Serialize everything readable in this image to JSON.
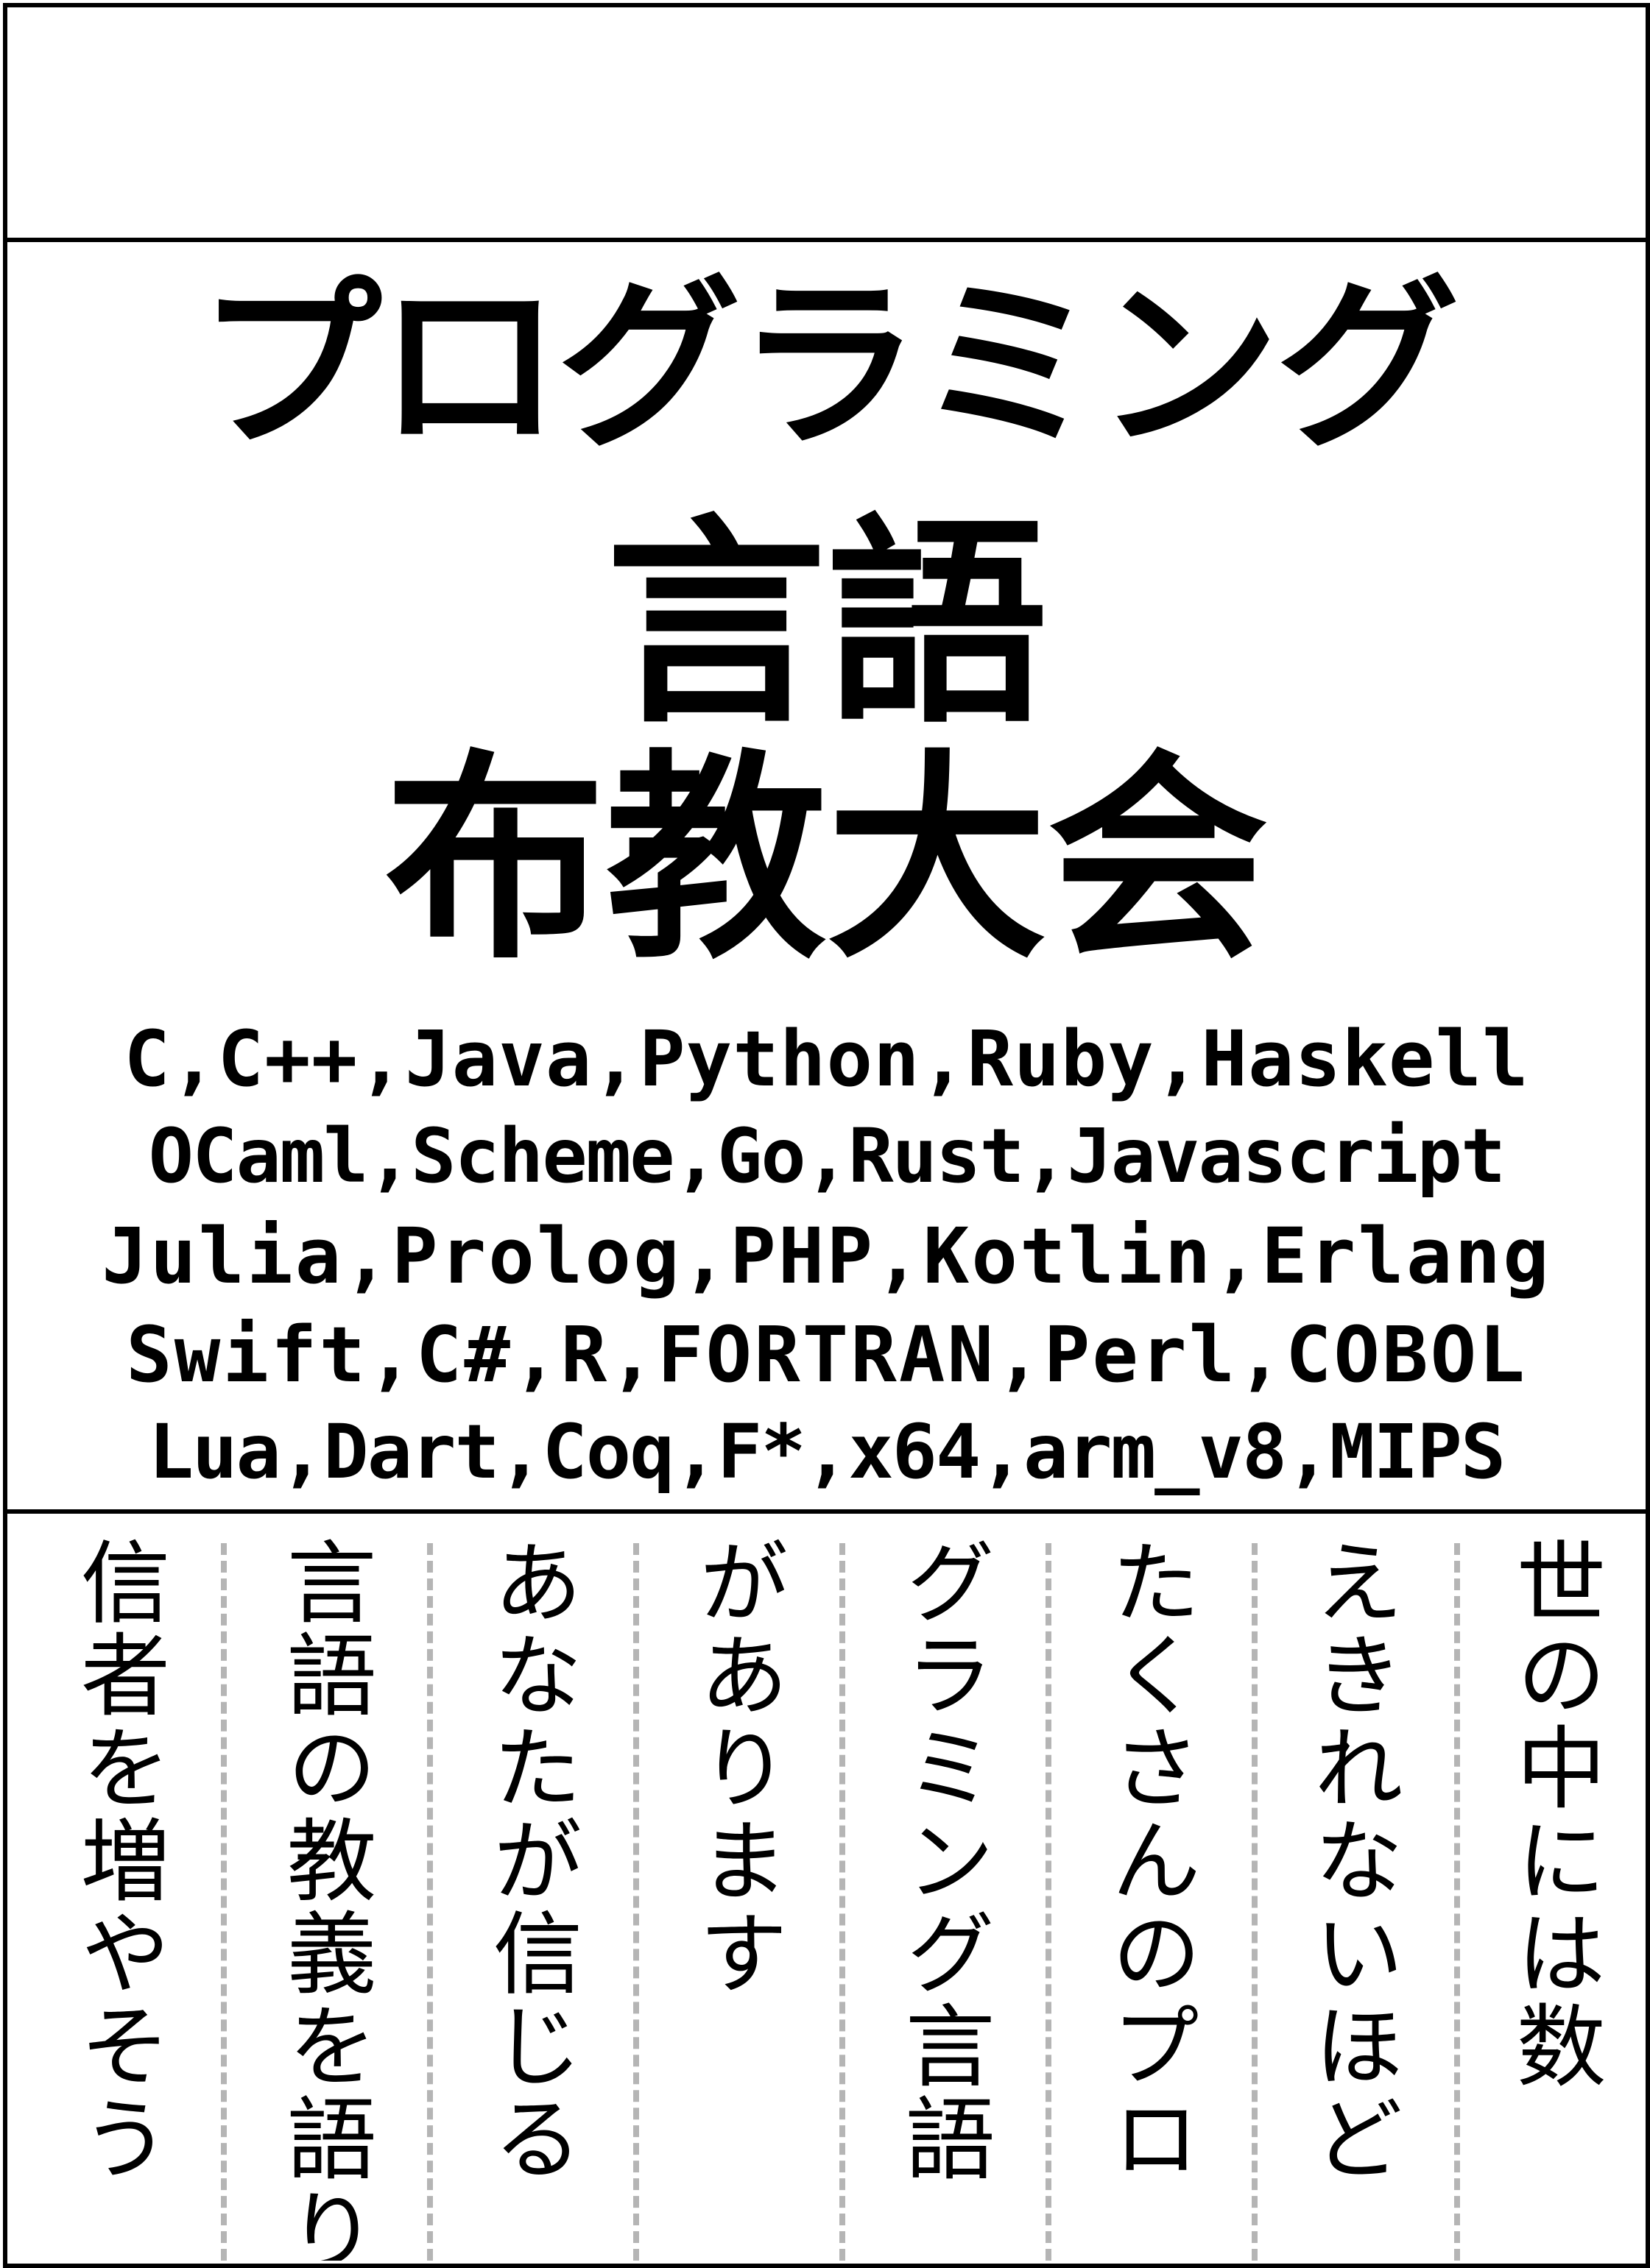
{
  "title": {
    "line1": "プログラミング",
    "line2": "言語",
    "line3": "布教大会"
  },
  "languages": [
    "C,C++,Java,Python,Ruby,Haskell",
    "OCaml,Scheme,Go,Rust,Javascript",
    "Julia,Prolog,PHP,Kotlin,Erlang",
    "Swift,C#,R,FORTRAN,Perl,COBOL",
    "Lua,Dart,Coq,F*,x64,arm_v8,MIPS"
  ],
  "body_columns": [
    "世の中には数",
    "えきれないほど",
    "たくさんのプロ",
    "グラミング言語",
    "があります",
    "あなたが信じる",
    "言語の教義を語り",
    "信者を増やそう"
  ],
  "colors": {
    "ink": "#000000",
    "paper": "#ffffff",
    "separator": "#b5b5b5"
  }
}
